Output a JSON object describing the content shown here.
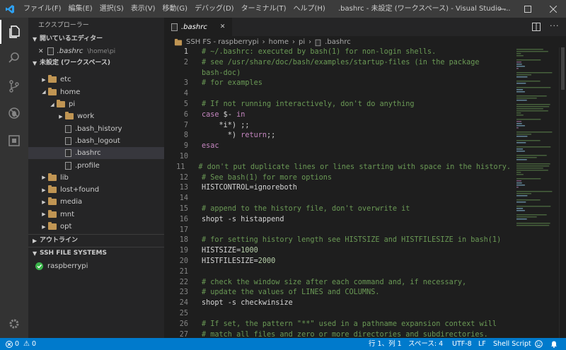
{
  "title_bar": {
    "menu": [
      "ファイル(F)",
      "編集(E)",
      "選択(S)",
      "表示(V)",
      "移動(G)",
      "デバッグ(D)",
      "ターミナル(T)",
      "ヘルプ(H)"
    ],
    "window_title": ".bashrc - 未設定 (ワークスペース) - Visual Studio ..."
  },
  "sidebar": {
    "title": "エクスプローラー",
    "open_editors": {
      "header": "開いているエディター",
      "file": ".bashrc",
      "path": "\\home\\pi"
    },
    "workspace": {
      "header": "未設定 (ワークスペース)",
      "tree": [
        {
          "label": "etc",
          "type": "folder",
          "depth": 0,
          "expanded": false
        },
        {
          "label": "home",
          "type": "folder",
          "depth": 0,
          "expanded": true
        },
        {
          "label": "pi",
          "type": "folder",
          "depth": 1,
          "expanded": true
        },
        {
          "label": "work",
          "type": "folder",
          "depth": 2,
          "expanded": false
        },
        {
          "label": ".bash_history",
          "type": "file",
          "depth": 2
        },
        {
          "label": ".bash_logout",
          "type": "file",
          "depth": 2
        },
        {
          "label": ".bashrc",
          "type": "file",
          "depth": 2,
          "selected": true
        },
        {
          "label": ".profile",
          "type": "file",
          "depth": 2
        },
        {
          "label": "lib",
          "type": "folder",
          "depth": 0,
          "expanded": false
        },
        {
          "label": "lost+found",
          "type": "folder",
          "depth": 0,
          "expanded": false
        },
        {
          "label": "media",
          "type": "folder",
          "depth": 0,
          "expanded": false
        },
        {
          "label": "mnt",
          "type": "folder",
          "depth": 0,
          "expanded": false
        },
        {
          "label": "opt",
          "type": "folder",
          "depth": 0,
          "expanded": false
        }
      ]
    },
    "outline_header": "アウトライン",
    "ssh_header": "SSH FILE SYSTEMS",
    "ssh_item": "raspberrypi"
  },
  "editor": {
    "tab_label": ".bashrc",
    "breadcrumb": [
      "SSH FS - raspberrypi",
      "home",
      "pi",
      ".bashrc"
    ],
    "lines": [
      {
        "n": "1",
        "t": [
          [
            "c",
            "# ~/.bashrc: executed by bash(1) for non-login shells."
          ]
        ]
      },
      {
        "n": "2",
        "t": [
          [
            "c",
            "# see /usr/share/doc/bash/examples/startup-files (in the package"
          ]
        ]
      },
      {
        "n": "",
        "t": [
          [
            "c",
            "bash-doc)"
          ]
        ]
      },
      {
        "n": "3",
        "t": [
          [
            "c",
            "# for examples"
          ]
        ]
      },
      {
        "n": "4",
        "t": []
      },
      {
        "n": "5",
        "t": [
          [
            "c",
            "# If not running interactively, don't do anything"
          ]
        ]
      },
      {
        "n": "6",
        "t": [
          [
            "p",
            "case"
          ],
          [
            "",
            " $- "
          ],
          [
            "p",
            "in"
          ]
        ]
      },
      {
        "n": "7",
        "t": [
          [
            "",
            "    *i*) ;;"
          ]
        ]
      },
      {
        "n": "8",
        "t": [
          [
            "",
            "      *) "
          ],
          [
            "p",
            "return"
          ],
          [
            "",
            ";;"
          ]
        ]
      },
      {
        "n": "9",
        "t": [
          [
            "p",
            "esac"
          ]
        ]
      },
      {
        "n": "10",
        "t": []
      },
      {
        "n": "11",
        "t": [
          [
            "c",
            "# don't put duplicate lines or lines starting with space in the history."
          ]
        ]
      },
      {
        "n": "12",
        "t": [
          [
            "c",
            "# See bash(1) for more options"
          ]
        ]
      },
      {
        "n": "13",
        "t": [
          [
            "",
            "HISTCONTROL=ignoreboth"
          ]
        ]
      },
      {
        "n": "14",
        "t": []
      },
      {
        "n": "15",
        "t": [
          [
            "c",
            "# append to the history file, don't overwrite it"
          ]
        ]
      },
      {
        "n": "16",
        "t": [
          [
            "",
            "shopt -s histappend"
          ]
        ]
      },
      {
        "n": "17",
        "t": []
      },
      {
        "n": "18",
        "t": [
          [
            "c",
            "# for setting history length see HISTSIZE and HISTFILESIZE in bash(1)"
          ]
        ]
      },
      {
        "n": "19",
        "t": [
          [
            "",
            "HISTSIZE="
          ],
          [
            "n",
            "1000"
          ]
        ]
      },
      {
        "n": "20",
        "t": [
          [
            "",
            "HISTFILESIZE="
          ],
          [
            "n",
            "2000"
          ]
        ]
      },
      {
        "n": "21",
        "t": []
      },
      {
        "n": "22",
        "t": [
          [
            "c",
            "# check the window size after each command and, if necessary,"
          ]
        ]
      },
      {
        "n": "23",
        "t": [
          [
            "c",
            "# update the values of LINES and COLUMNS."
          ]
        ]
      },
      {
        "n": "24",
        "t": [
          [
            "",
            "shopt -s checkwinsize"
          ]
        ]
      },
      {
        "n": "25",
        "t": []
      },
      {
        "n": "26",
        "t": [
          [
            "c",
            "# If set, the pattern \"**\" used in a pathname expansion context will"
          ]
        ]
      },
      {
        "n": "27",
        "t": [
          [
            "c",
            "# match all files and zero or more directories and subdirectories."
          ]
        ]
      }
    ]
  },
  "status_bar": {
    "errors": "0",
    "warnings": "0",
    "position": "行 1、列 1",
    "spaces": "スペース: 4",
    "encoding": "UTF-8",
    "eol": "LF",
    "language": "Shell Script"
  },
  "colors": {
    "accent": "#007acc",
    "folder": "#c09553",
    "comment": "#6a9955",
    "keyword": "#c586c0",
    "number": "#b5cea8"
  }
}
